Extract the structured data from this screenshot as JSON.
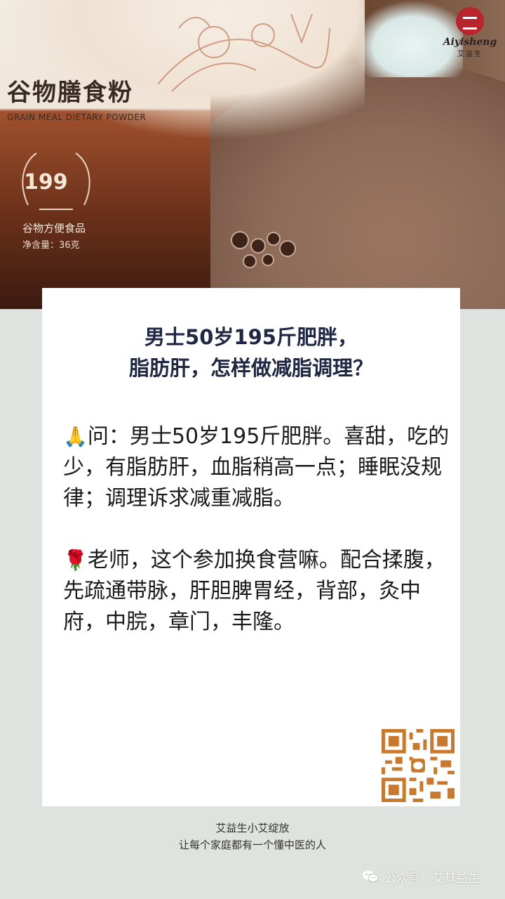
{
  "photo": {
    "bag_title": "谷物膳食粉",
    "bag_subtitle": "GRAIN MEAL DIETARY POWDER",
    "badge_number": "199",
    "bag_line1": "谷物方便食品",
    "bag_line2": "净含量：36克",
    "logo_en": "Aiyisheng",
    "logo_cn": "艾益生"
  },
  "article": {
    "title_line1": "男士50岁195斤肥胖，",
    "title_line2": "脂肪肝，怎样做减脂调理？",
    "question_emoji": "🙏",
    "question": "问：男士50岁195斤肥胖。喜甜，吃的少，有脂肪肝，血脂稍高一点；睡眠没规律；调理诉求减重减脂。",
    "answer_emoji": "🌹",
    "answer": "老师，这个参加换食营嘛。配合揉腹，先疏通带脉，肝胆脾胃经，背部，灸中府，中脘，章门，丰隆。"
  },
  "footer": {
    "line1": "艾益生小艾绽放",
    "line2": "让每个家庭都有一个懂中医的人"
  },
  "watermark": {
    "label": "公众号",
    "dot": "·",
    "account": "艾其益生"
  }
}
